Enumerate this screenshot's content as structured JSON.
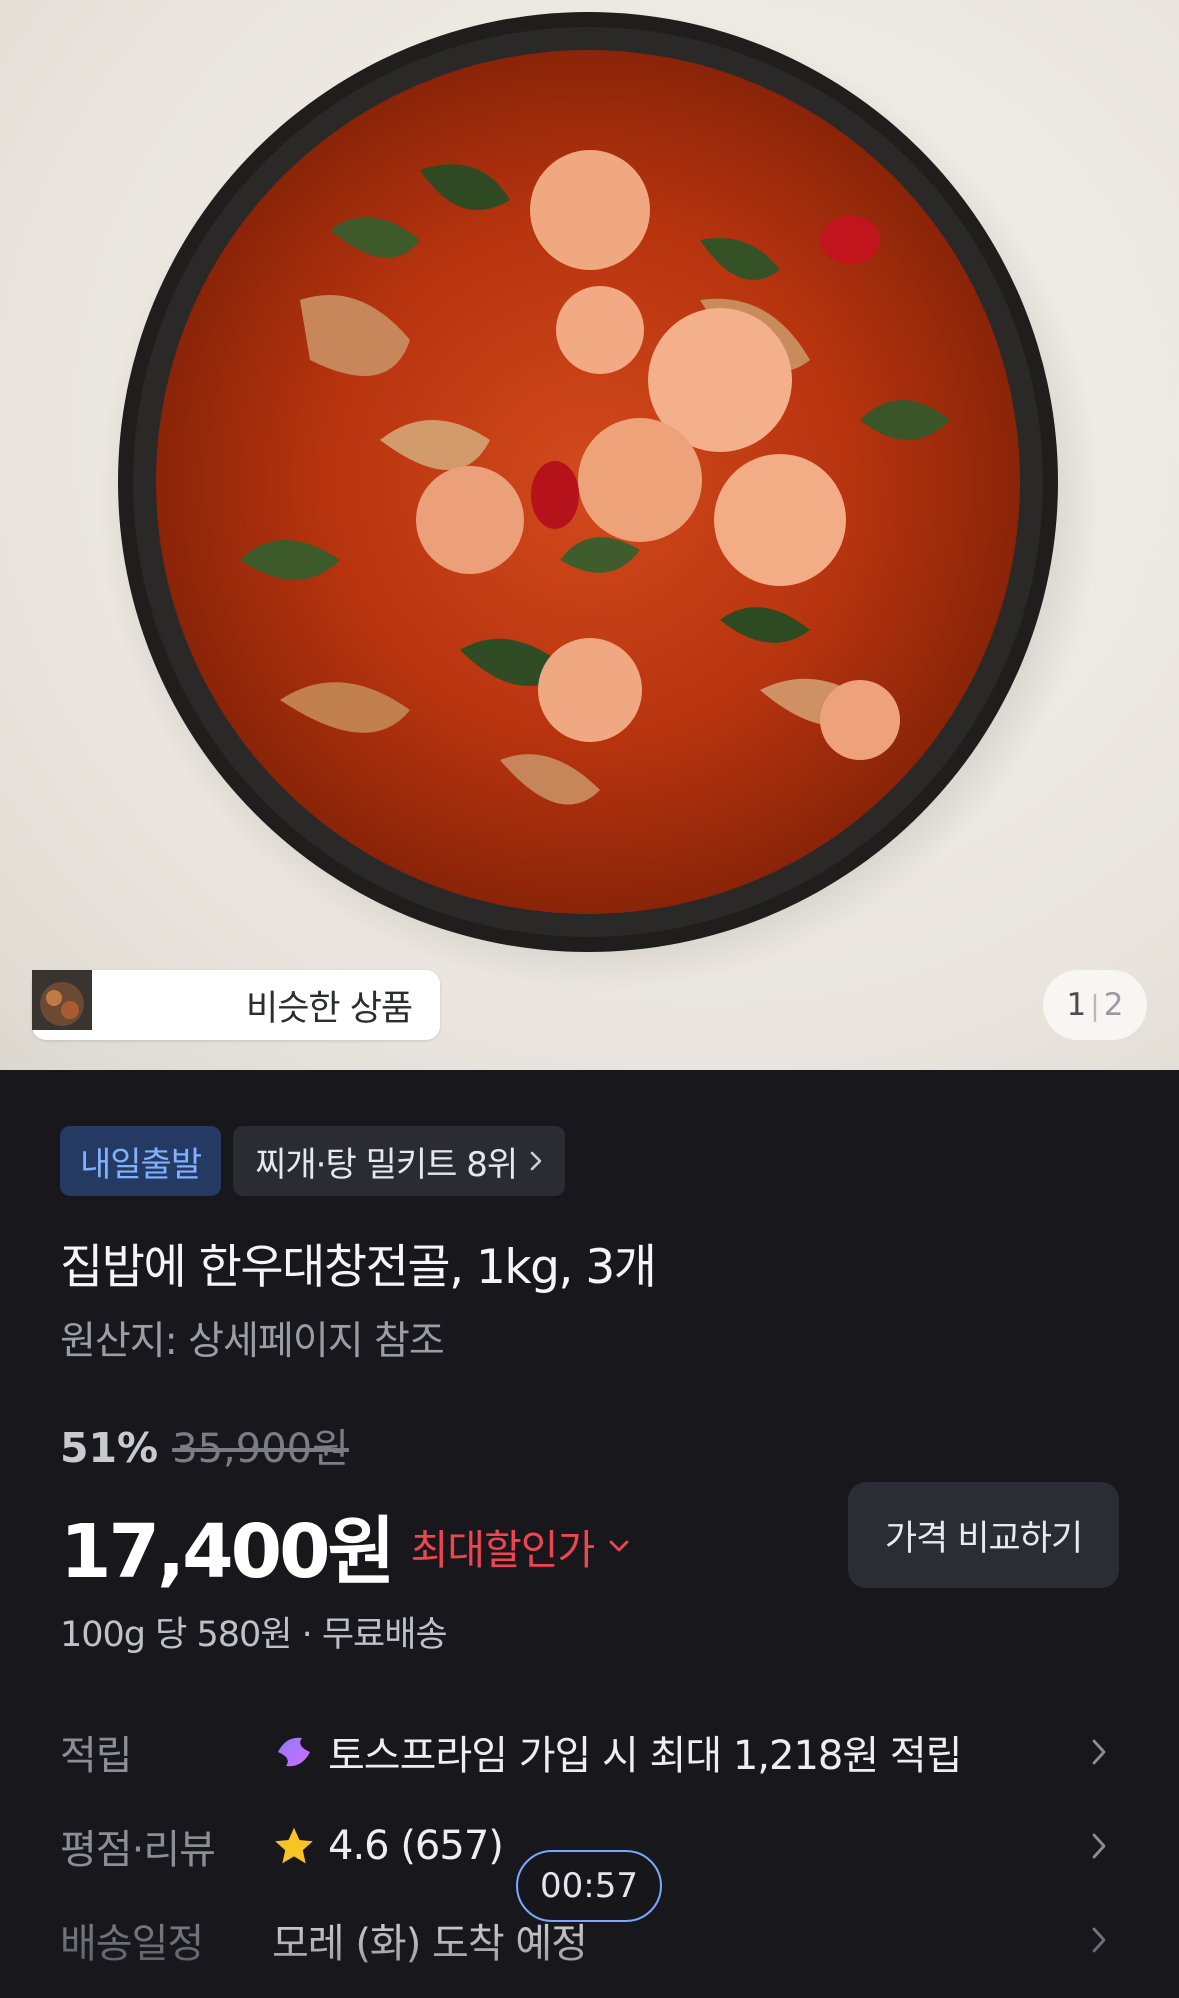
{
  "hero": {
    "similar_label": "비슷한 상품",
    "page_current": "1",
    "page_total": "2"
  },
  "tags": {
    "delivery": "내일출발",
    "rank": "찌개·탕 밀키트 8위"
  },
  "product": {
    "title": "집밥에 한우대창전골, 1kg, 3개",
    "origin": "원산지: 상세페이지 참조"
  },
  "price": {
    "discount_rate": "51%",
    "original": "35,900원",
    "current": "17,400원",
    "max_discount_label": "최대할인가",
    "compare_button": "가격 비교하기",
    "unit_price": "100g 당 580원 · 무료배송"
  },
  "info": {
    "reward_label": "적립",
    "reward_value": "토스프라임 가입 시 최대 1,218원 적립",
    "rating_label": "평점·리뷰",
    "rating_value": "4.6 (657)",
    "delivery_label": "배송일정",
    "delivery_value": "모레 (화) 도착 예정"
  },
  "timer": "00:57",
  "colors": {
    "background": "#17171c",
    "accent_red": "#f04452",
    "tag_blue_bg": "#243a63",
    "tag_blue_text": "#7fb1ff",
    "star": "#f7c325"
  },
  "icons": [
    "chevron-right-icon",
    "chevron-down-icon",
    "toss-prime-icon",
    "star-icon"
  ]
}
